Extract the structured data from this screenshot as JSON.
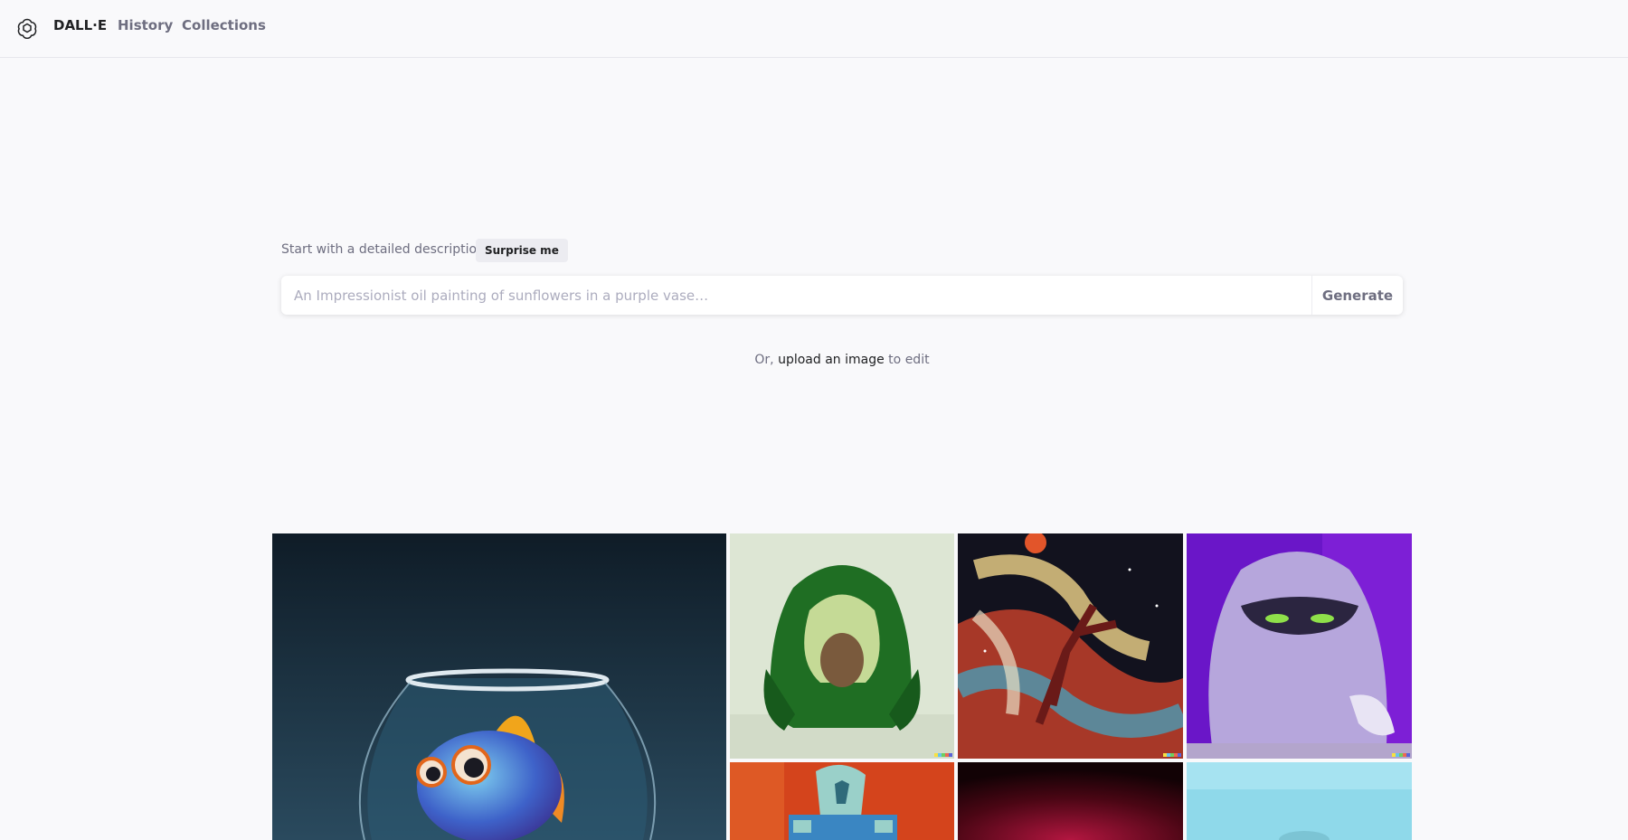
{
  "header": {
    "brand": "DALL·E",
    "nav": {
      "history": "History",
      "collections": "Collections"
    }
  },
  "prompt": {
    "label": "Start with a detailed description",
    "surprise_label": "Surprise me",
    "placeholder": "An Impressionist oil painting of sunflowers in a purple vase…",
    "value": "",
    "generate_label": "Generate"
  },
  "upload": {
    "prefix": "Or, ",
    "link": "upload an image",
    "suffix": " to edit"
  },
  "icons": {
    "logo": "openai-logo-icon"
  },
  "colors": {
    "text_primary": "#202123",
    "text_secondary": "#6e6e80",
    "placeholder": "#acacbe",
    "background": "#f9f9fb"
  }
}
